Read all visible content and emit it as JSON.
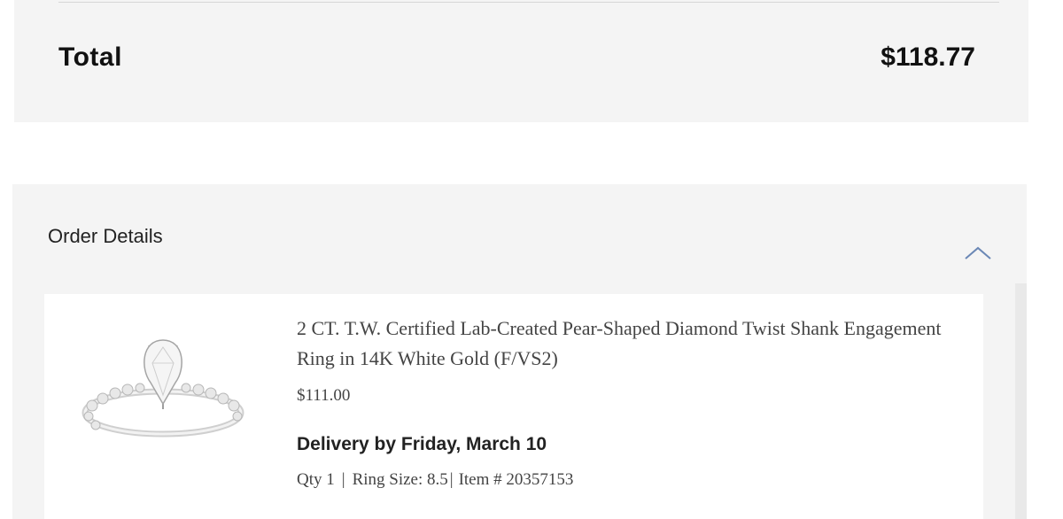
{
  "summary": {
    "total_label": "Total",
    "total_value": "$118.77"
  },
  "order_details": {
    "title": "Order Details",
    "collapse_icon": "chevron-up-icon",
    "accent_color": "#6a87b5",
    "items": [
      {
        "image_icon": "ring-image",
        "title": "2 CT. T.W. Certified Lab-Created Pear-Shaped Diamond Twist Shank Engagement Ring in 14K White Gold (F/VS2)",
        "price": "$111.00",
        "delivery": "Delivery by Friday, March 10",
        "qty": "Qty 1",
        "ring_size": "Ring Size: 8.5",
        "item_number": "Item # 20357153",
        "separator": "|"
      }
    ]
  }
}
